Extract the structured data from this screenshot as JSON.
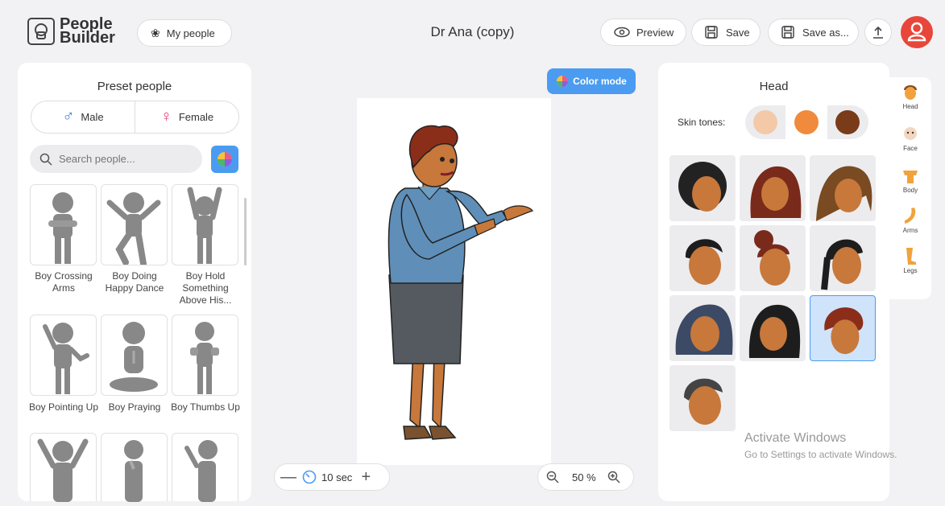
{
  "header": {
    "logo_line1": "People",
    "logo_line2": "Builder",
    "my_people_label": "My people",
    "document_title": "Dr Ana (copy)",
    "preview_label": "Preview",
    "save_label": "Save",
    "save_as_label": "Save as..."
  },
  "left_panel": {
    "title": "Preset people",
    "gender_tabs": [
      "Male",
      "Female"
    ],
    "search_placeholder": "Search people...",
    "presets": [
      {
        "label": "Boy Crossing Arms"
      },
      {
        "label": "Boy Doing Happy Dance"
      },
      {
        "label": "Boy Hold Something Above His..."
      },
      {
        "label": "Boy Pointing Up"
      },
      {
        "label": "Boy Praying"
      },
      {
        "label": "Boy Thumbs Up"
      }
    ]
  },
  "canvas": {
    "color_mode_label": "Color mode",
    "timer_label": "10 sec",
    "zoom_label": "50 %"
  },
  "right_panel": {
    "title": "Head",
    "skin_tones_label": "Skin tones:",
    "skin_tones": [
      "#f3c9a8",
      "#f08a3c",
      "#7a3b18"
    ],
    "selected_skin_tone": 1,
    "hair_selected_index": 8
  },
  "side_tabs": [
    "Head",
    "Face",
    "Body",
    "Arms",
    "Legs"
  ],
  "watermark": {
    "line1": "Activate Windows",
    "line2": "Go to Settings to activate Windows."
  },
  "colors": {
    "accent_blue": "#4b9cf0",
    "female_pink": "#e03a7a",
    "male_blue": "#3b7de0",
    "avatar_red": "#e8463a",
    "selected_card": "#cfe3fb"
  }
}
